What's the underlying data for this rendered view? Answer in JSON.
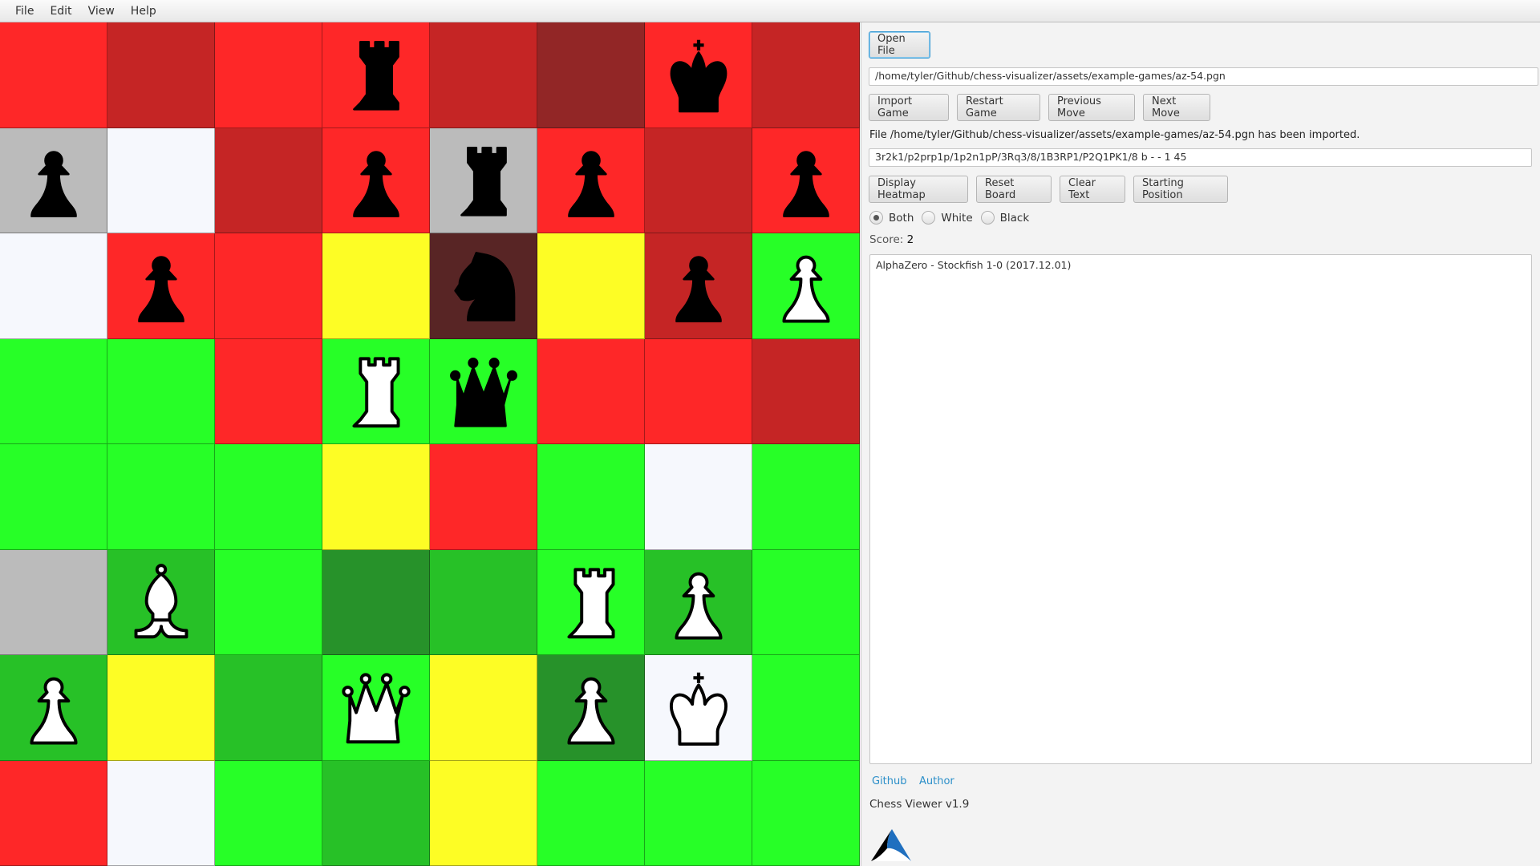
{
  "menu": [
    "File",
    "Edit",
    "View",
    "Help"
  ],
  "board": {
    "colors": {
      "R": "#fe2728",
      "r": "#c52525",
      "m": "#922626",
      "k": "#582525",
      "G": "#27ff27",
      "g": "#27c127",
      "d": "#27922a",
      "Y": "#fdfd25",
      "W": "#f6f8fd",
      "S": "#bbbbbb"
    },
    "heat": [
      [
        "R",
        "r",
        "R",
        "R",
        "r",
        "m",
        "R",
        "r"
      ],
      [
        "S",
        "W",
        "r",
        "R",
        "S",
        "R",
        "r",
        "R"
      ],
      [
        "W",
        "R",
        "R",
        "Y",
        "k",
        "Y",
        "r",
        "G"
      ],
      [
        "G",
        "G",
        "R",
        "G",
        "G",
        "R",
        "R",
        "r"
      ],
      [
        "G",
        "G",
        "G",
        "Y",
        "R",
        "G",
        "W",
        "G"
      ],
      [
        "S",
        "g",
        "G",
        "d",
        "g",
        "G",
        "g",
        "G"
      ],
      [
        "g",
        "Y",
        "g",
        "G",
        "Y",
        "d",
        "W",
        "G"
      ],
      [
        "R",
        "W",
        "G",
        "g",
        "Y",
        "G",
        "G",
        "G"
      ]
    ],
    "pieces": [
      [
        "",
        "",
        "",
        "bR",
        "",
        "",
        "bK",
        ""
      ],
      [
        "bP",
        "",
        "",
        "bP",
        "bR",
        "bP",
        "",
        "bP"
      ],
      [
        "",
        "bP",
        "",
        "",
        "bN",
        "",
        "bP",
        "wP"
      ],
      [
        "",
        "",
        "",
        "wR",
        "bQ",
        "",
        "",
        ""
      ],
      [
        "",
        "",
        "",
        "",
        "",
        "",
        "",
        ""
      ],
      [
        "",
        "wB",
        "",
        "",
        "",
        "wR",
        "wP",
        ""
      ],
      [
        "wP",
        "",
        "",
        "wQ",
        "",
        "wP",
        "wK",
        ""
      ],
      [
        "",
        "",
        "",
        "",
        "",
        "",
        "",
        ""
      ]
    ]
  },
  "panel": {
    "open_file_label": "Open File",
    "file_path": "/home/tyler/Github/chess-visualizer/assets/example-games/az-54.pgn",
    "import_game_label": "Import Game",
    "restart_game_label": "Restart Game",
    "previous_move_label": "Previous Move",
    "next_move_label": "Next Move",
    "status_message": "File /home/tyler/Github/chess-visualizer/assets/example-games/az-54.pgn has been imported.",
    "fen": "3r2k1/p2prp1p/1p2n1pP/3Rq3/8/1B3RP1/P2Q1PK1/8 b - - 1 45",
    "display_heatmap_label": "Display Heatmap",
    "reset_board_label": "Reset Board",
    "clear_text_label": "Clear Text",
    "starting_position_label": "Starting Position",
    "radio_options": [
      {
        "label": "Both",
        "selected": true
      },
      {
        "label": "White",
        "selected": false
      },
      {
        "label": "Black",
        "selected": false
      }
    ],
    "score_label": "Score:",
    "score_value": "2",
    "game_text": "AlphaZero - Stockfish 1-0 (2017.12.01)",
    "github_link": "Github",
    "author_link": "Author",
    "version": "Chess Viewer v1.9",
    "logo_icon": "app-logo-icon"
  }
}
